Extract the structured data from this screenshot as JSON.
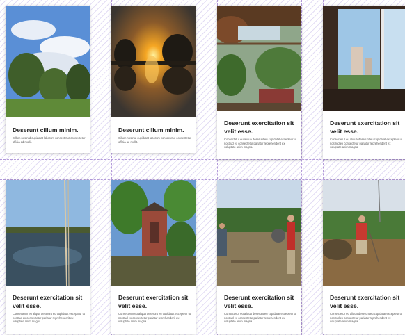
{
  "cards": [
    {
      "title": "Deserunt cillum minim.",
      "body": "Cillum nostrud cupidatat laborum consectetur consectetur officia ad mollit.",
      "image": "trees-under-blue-sky-photo"
    },
    {
      "title": "Deserunt cillum minim.",
      "body": "Cillum nostrud cupidatat laborum consectetur consectetur officia ad mollit.",
      "image": "sunset-over-lake-photo"
    },
    {
      "title": "Deserunt exercitation sit velit esse.",
      "body": "Consectetur eu aliqua deserunt eu cupidatat excepteur ut nostrud ex consectetur pariatur reprehenderit ex voluptate anim magna.",
      "image": "garden-pergola-photo"
    },
    {
      "title": "Deserunt exercitation sit velit esse.",
      "body": "Consectetur eu aliqua deserunt eu cupidatat excepteur ut nostrud ex consectetur pariatur reprehenderit ex voluptate anim magna.",
      "image": "window-city-view-photo"
    },
    {
      "title": "Deserunt exercitation sit velit esse.",
      "body": "Consectetur eu aliqua deserunt eu cupidatat excepteur ut nostrud ex consectetur pariatur reprehenderit ex voluptate anim magna.",
      "image": "calm-lake-photo"
    },
    {
      "title": "Deserunt exercitation sit velit esse.",
      "body": "Consectetur eu aliqua deserunt eu cupidatat excepteur ut nostrud ex consectetur pariatur reprehenderit ex voluptate anim magna.",
      "image": "brick-well-garden-photo"
    },
    {
      "title": "Deserunt exercitation sit velit esse.",
      "body": "Consectetur eu aliqua deserunt eu cupidatat excepteur ut nostrud ex consectetur pariatur reprehenderit ex voluptate anim magna.",
      "image": "barbecue-field-photo"
    },
    {
      "title": "Deserunt exercitation sit velit esse.",
      "body": "Consectetur eu aliqua deserunt eu cupidatat excepteur ut nostrud ex consectetur pariatur reprehenderit ex voluptate anim magna.",
      "image": "man-working-field-photo"
    }
  ]
}
